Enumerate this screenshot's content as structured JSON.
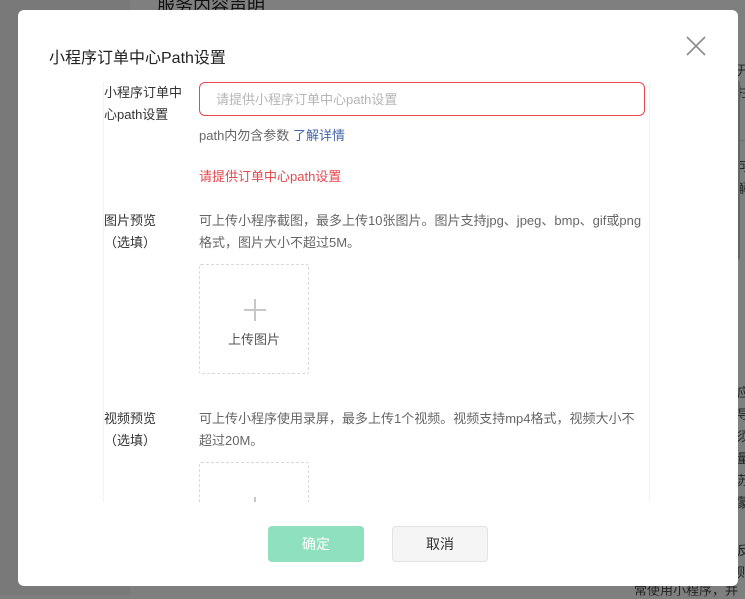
{
  "background": {
    "heading": "服务内容声明",
    "fragments": [
      "开",
      "拄",
      "可",
      "解",
      "应",
      "导",
      "须",
      "量",
      "苏",
      "蒙",
      "反",
      "则",
      "常使用小程序，并"
    ]
  },
  "modal": {
    "title": "小程序订单中心Path设置",
    "close_icon": "close-icon",
    "path_field": {
      "label": "小程序订单中心path设置",
      "placeholder": "请提供小程序订单中心path设置",
      "value": "",
      "hint": "path内勿含参数",
      "hint_link": "了解详情",
      "error": "请提供订单中心path设置"
    },
    "image_preview": {
      "label": "图片预览",
      "label_sub": "（选填）",
      "description": "可上传小程序截图，最多上传10张图片。图片支持jpg、jpeg、bmp、gif或png格式，图片大小不超过5M。",
      "upload_label": "上传图片"
    },
    "video_preview": {
      "label": "视频预览",
      "label_sub": "（选填）",
      "description": "可上传小程序使用录屏，最多上传1个视频。视频支持mp4格式，视频大小不超过20M。"
    },
    "buttons": {
      "confirm": "确定",
      "cancel": "取消"
    }
  }
}
